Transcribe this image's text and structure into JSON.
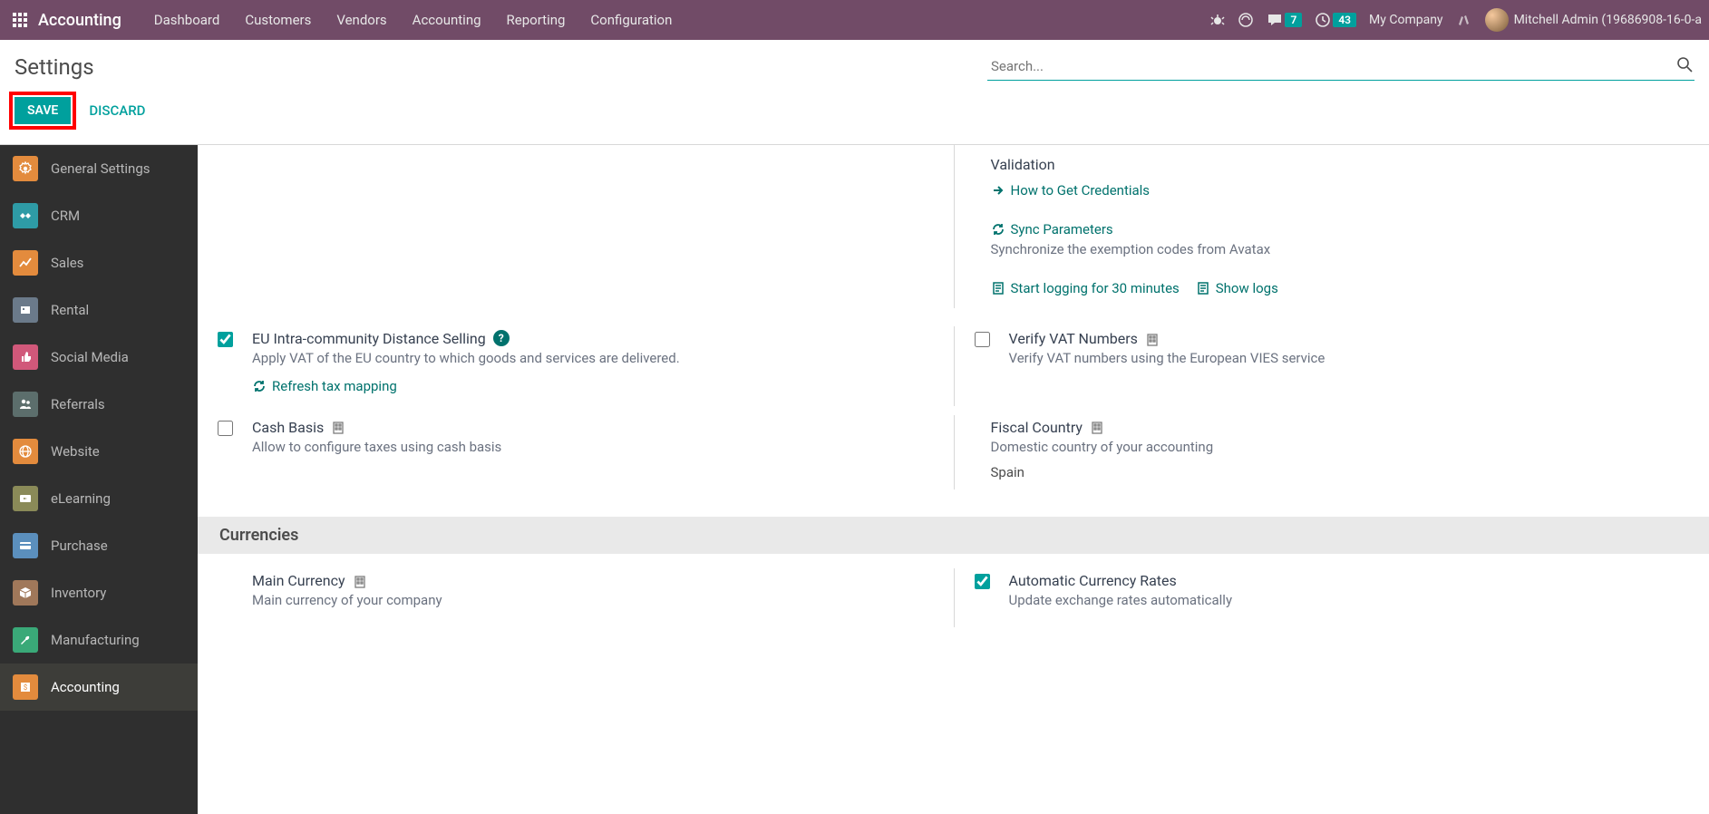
{
  "header": {
    "brand": "Accounting",
    "menu": [
      "Dashboard",
      "Customers",
      "Vendors",
      "Accounting",
      "Reporting",
      "Configuration"
    ],
    "chat_badge": "7",
    "activity_badge": "43",
    "company": "My Company",
    "user": "Mitchell Admin (19686908-16-0-a"
  },
  "ctrl": {
    "title": "Settings",
    "search_placeholder": "Search...",
    "save": "SAVE",
    "discard": "DISCARD"
  },
  "sidebar": {
    "items": [
      {
        "label": "General Settings"
      },
      {
        "label": "CRM"
      },
      {
        "label": "Sales"
      },
      {
        "label": "Rental"
      },
      {
        "label": "Social Media"
      },
      {
        "label": "Referrals"
      },
      {
        "label": "Website"
      },
      {
        "label": "eLearning"
      },
      {
        "label": "Purchase"
      },
      {
        "label": "Inventory"
      },
      {
        "label": "Manufacturing"
      },
      {
        "label": "Accounting"
      }
    ]
  },
  "settings": {
    "validation_title": "Validation",
    "how_credentials": "How to Get Credentials",
    "sync_params": "Sync Parameters",
    "sync_desc": "Synchronize the exemption codes from Avatax",
    "start_logging": "Start logging for 30 minutes",
    "show_logs": "Show logs",
    "eu_title": "EU Intra-community Distance Selling",
    "eu_desc": "Apply VAT of the EU country to which goods and services are delivered.",
    "refresh_tax": "Refresh tax mapping",
    "vat_title": "Verify VAT Numbers",
    "vat_desc": "Verify VAT numbers using the European VIES service",
    "cash_title": "Cash Basis",
    "cash_desc": "Allow to configure taxes using cash basis",
    "fiscal_title": "Fiscal Country",
    "fiscal_desc": "Domestic country of your accounting",
    "fiscal_value": "Spain",
    "currencies_section": "Currencies",
    "main_curr_title": "Main Currency",
    "main_curr_desc": "Main currency of your company",
    "auto_curr_title": "Automatic Currency Rates",
    "auto_curr_desc": "Update exchange rates automatically"
  }
}
